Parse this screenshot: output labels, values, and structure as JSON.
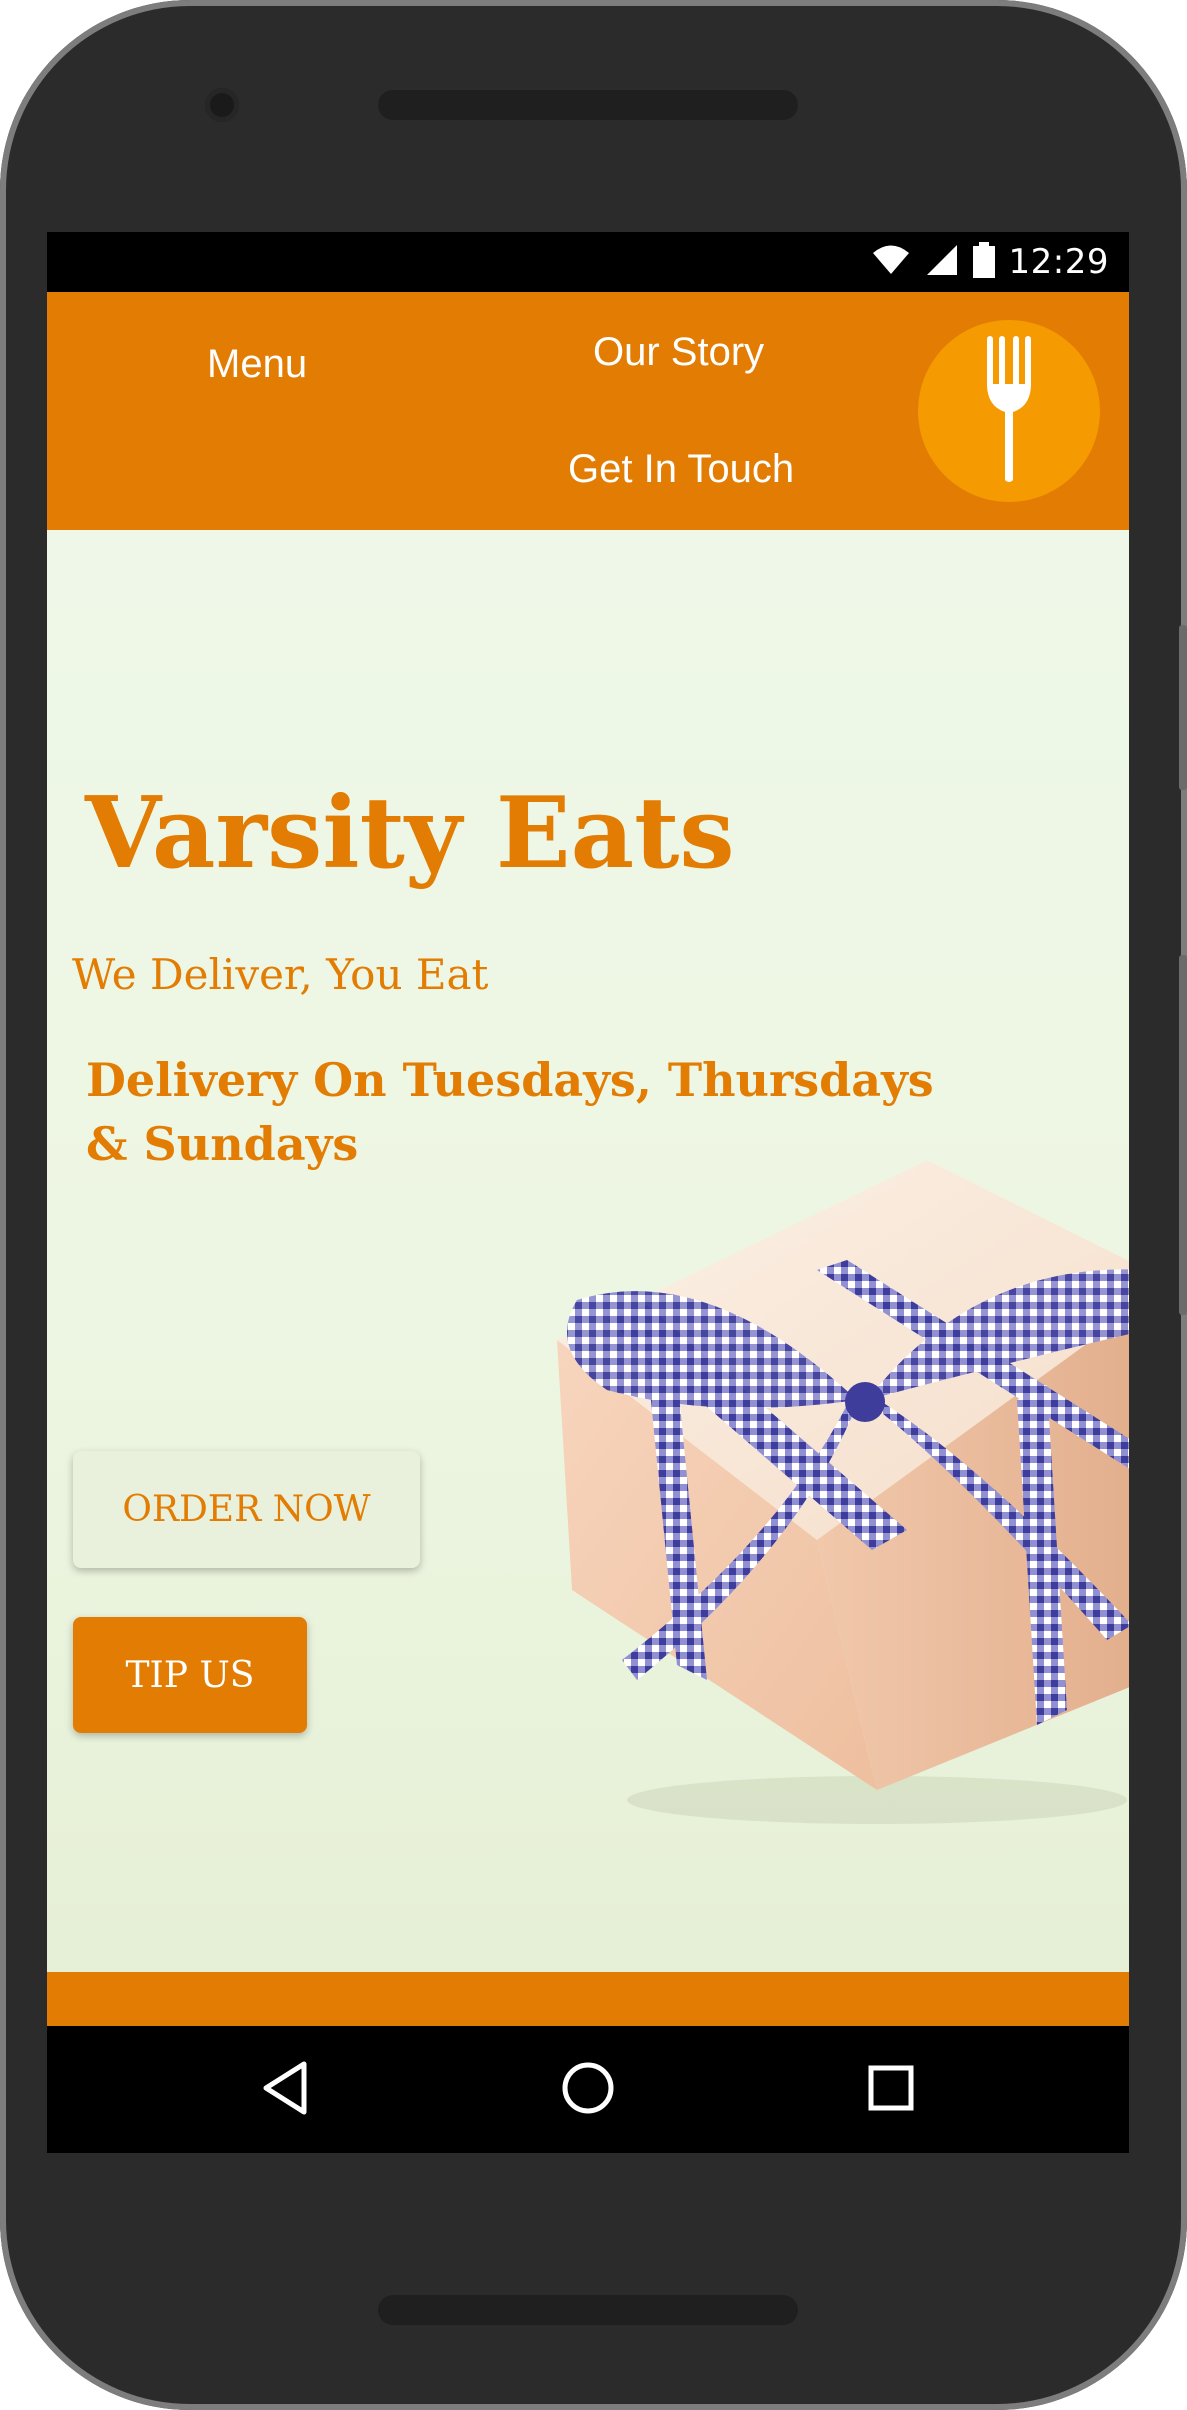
{
  "status_bar": {
    "time": "12:29",
    "icons": [
      "wifi-icon",
      "cell-signal-icon",
      "battery-icon"
    ]
  },
  "header": {
    "nav": {
      "menu": "Menu",
      "our_story": "Our Story",
      "get_in_touch": "Get In Touch"
    },
    "logo_icon": "fork-icon"
  },
  "hero": {
    "title": "Varsity Eats",
    "tagline": "We Deliver, You Eat",
    "delivery_days": "Delivery On Tuesdays, Thursdays & Sundays",
    "order_button": "ORDER NOW",
    "tip_button": "TIP US",
    "image_icon": "gift-box-image"
  },
  "system_nav": {
    "icons": [
      "back-icon",
      "home-icon",
      "recent-apps-icon"
    ]
  },
  "colors": {
    "brand_orange": "#e27c02",
    "logo_orange": "#f69a02",
    "hero_background": "#eff8e8",
    "order_button_background": "#e9f1dc"
  }
}
